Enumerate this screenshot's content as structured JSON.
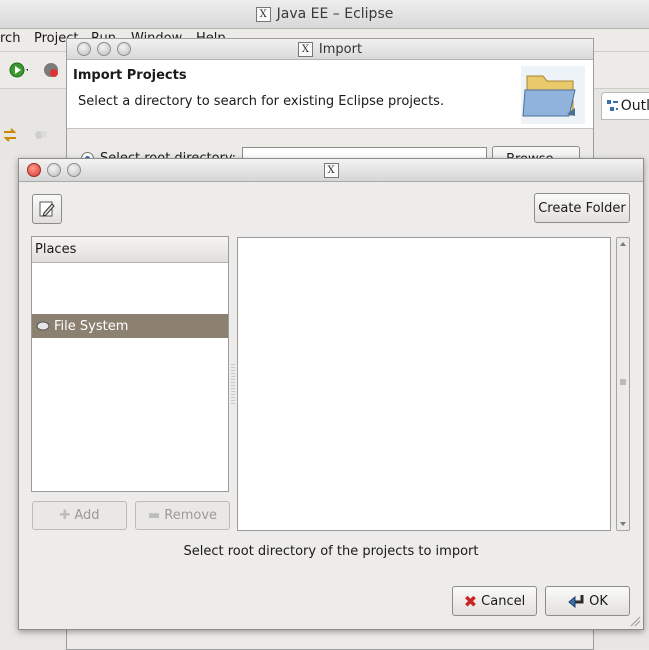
{
  "eclipse": {
    "title": "Java EE – Eclipse",
    "menu": [
      "rch",
      "Project",
      "Run",
      "Window",
      "Help"
    ],
    "outline_tab": "Outl"
  },
  "import_wizard": {
    "title": "Import",
    "header_title": "Import Projects",
    "header_desc": "Select a directory to search for existing Eclipse projects.",
    "radio_label": "Select root directory:",
    "browse_label": "Browse..."
  },
  "chooser": {
    "title": "",
    "create_folder_label": "Create Folder",
    "places_header": "Places",
    "places": [
      "File System"
    ],
    "add_label": "Add",
    "remove_label": "Remove",
    "status": "Select root directory of the projects to import",
    "cancel_label": "Cancel",
    "ok_label": "OK"
  },
  "colors": {
    "selected_place": "#8c8170",
    "close_button": "#d8362c"
  }
}
